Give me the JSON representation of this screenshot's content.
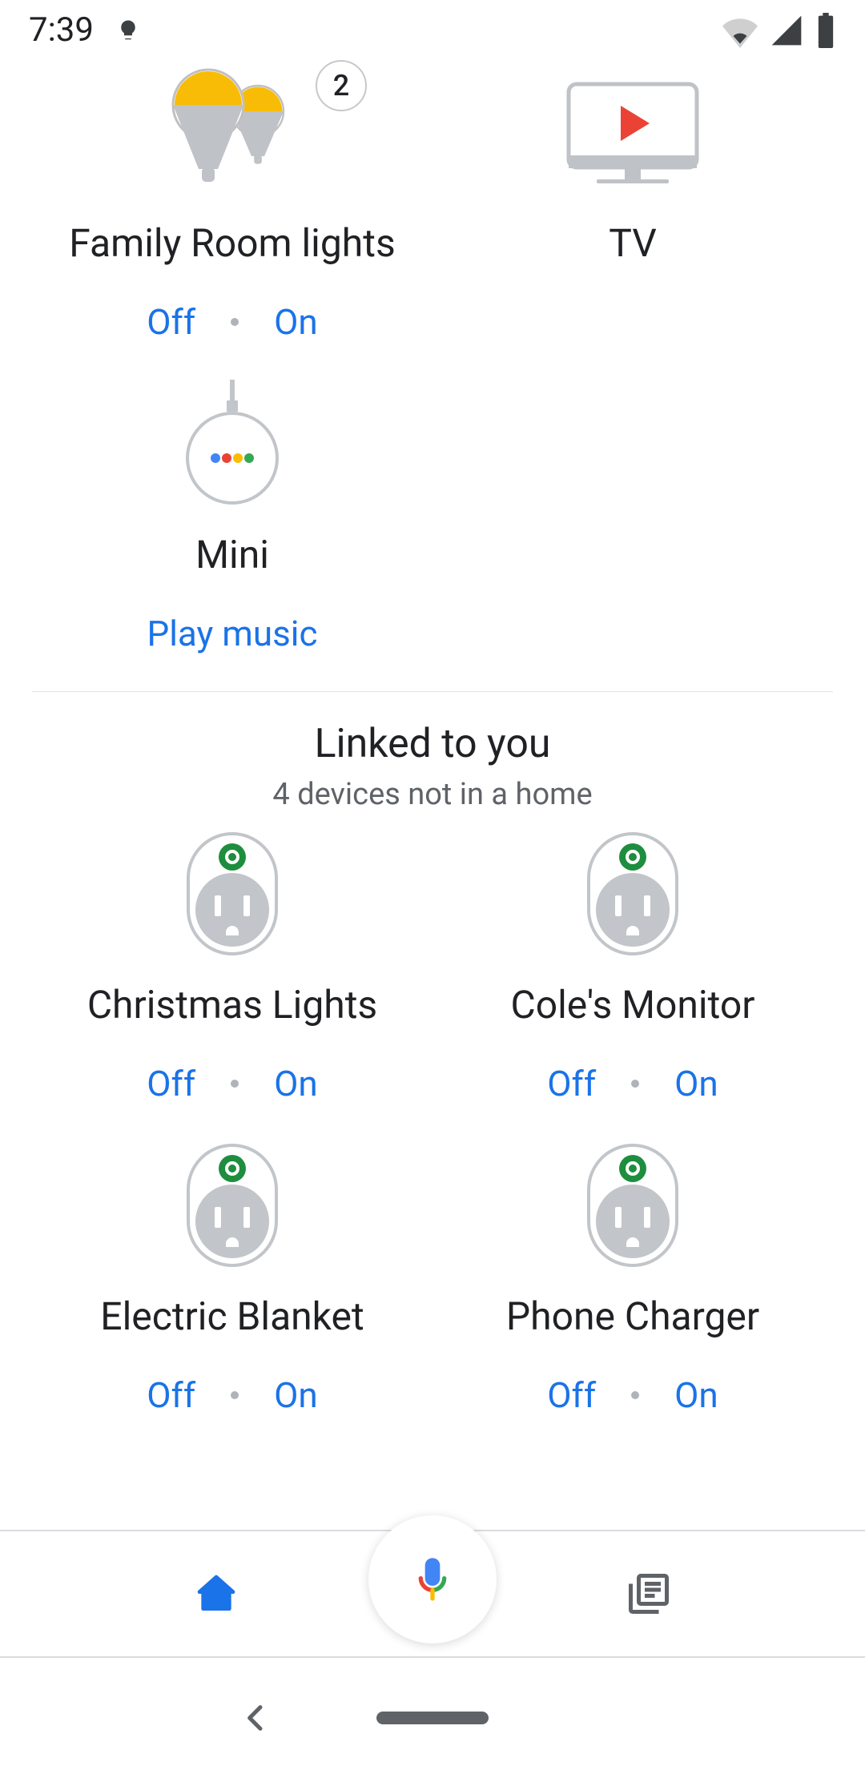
{
  "statusbar": {
    "time": "7:39"
  },
  "room_devices": [
    {
      "name": "Family Room lights",
      "type": "light_group",
      "count": "2",
      "off_label": "Off",
      "on_label": "On"
    },
    {
      "name": "TV",
      "type": "tv"
    },
    {
      "name": "Mini",
      "type": "speaker",
      "action_label": "Play music"
    }
  ],
  "linked": {
    "title": "Linked to you",
    "subtitle": "4 devices not in a home",
    "devices": [
      {
        "name": "Christmas Lights",
        "off_label": "Off",
        "on_label": "On"
      },
      {
        "name": "Cole's Monitor",
        "off_label": "Off",
        "on_label": "On"
      },
      {
        "name": "Electric Blanket",
        "off_label": "Off",
        "on_label": "On"
      },
      {
        "name": "Phone Charger",
        "off_label": "Off",
        "on_label": "On"
      }
    ]
  },
  "colors": {
    "link": "#1a73e8",
    "text": "#202124",
    "subtext": "#5f6368",
    "google_blue": "#4285f4",
    "google_red": "#ea4335",
    "google_yellow": "#fbbc04",
    "google_green": "#34a853"
  }
}
